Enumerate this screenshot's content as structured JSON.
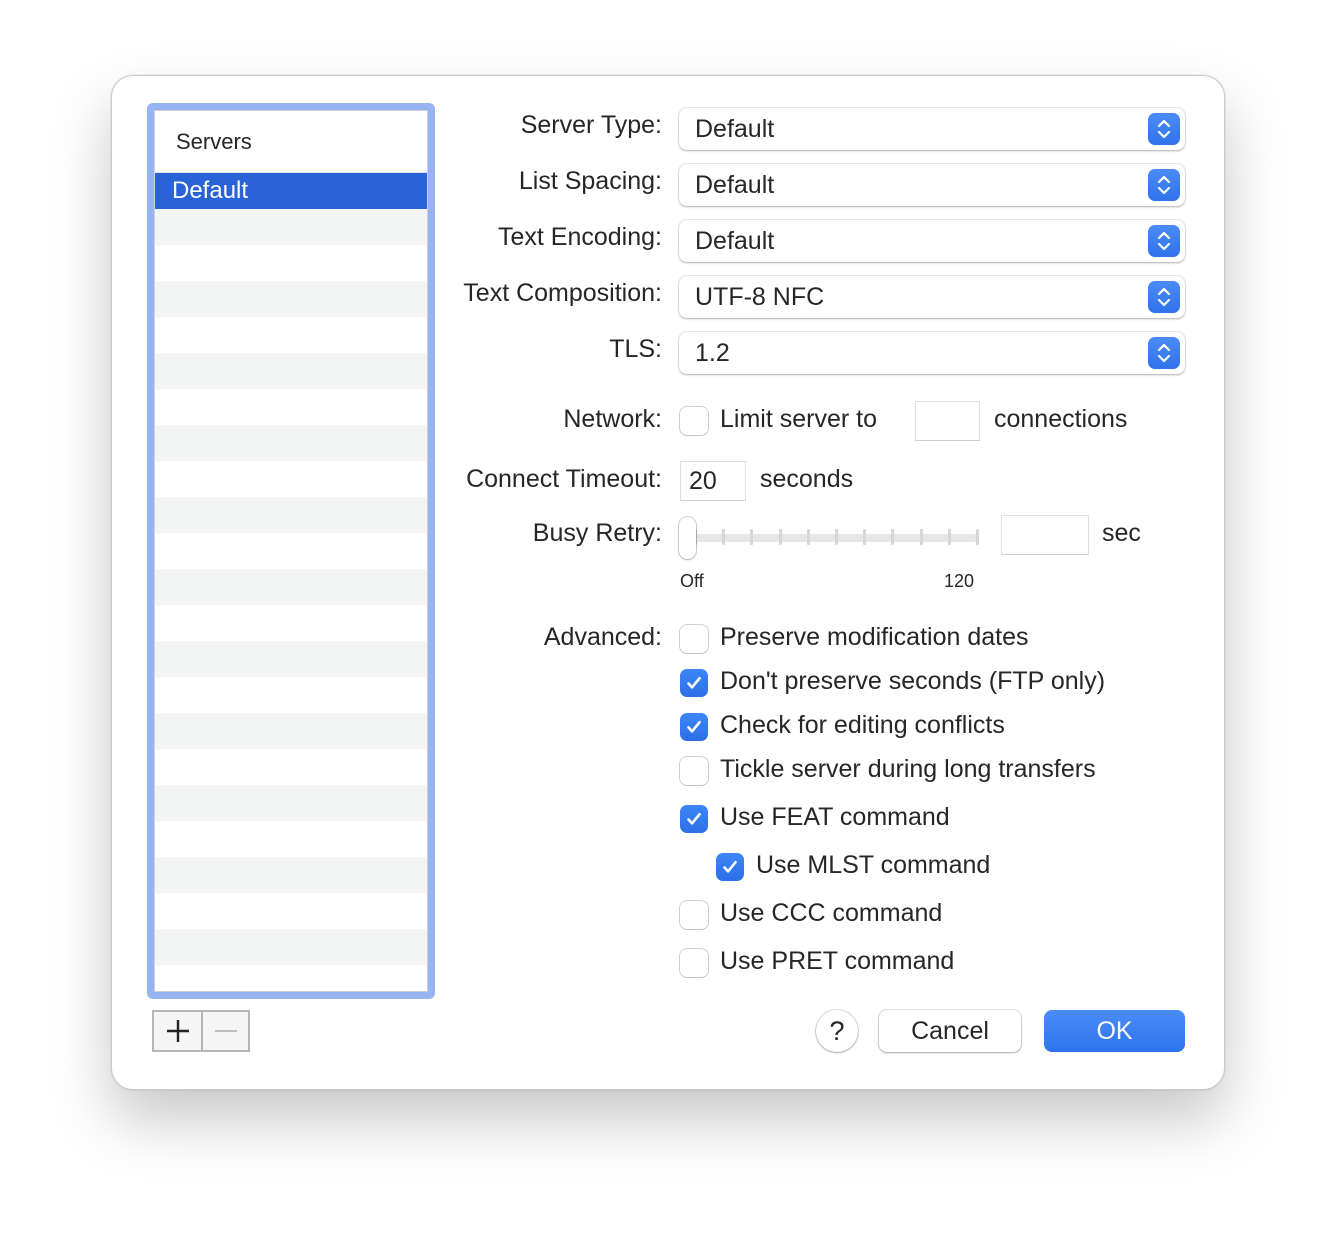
{
  "sidebar": {
    "header": "Servers",
    "items": [
      {
        "label": "Default",
        "selected": true
      }
    ],
    "add_icon": "plus-icon",
    "remove_icon": "minus-icon"
  },
  "form": {
    "server_type": {
      "label": "Server Type:",
      "value": "Default"
    },
    "list_spacing": {
      "label": "List Spacing:",
      "value": "Default"
    },
    "text_encoding": {
      "label": "Text Encoding:",
      "value": "Default"
    },
    "text_composition": {
      "label": "Text Composition:",
      "value": "UTF-8 NFC"
    },
    "tls": {
      "label": "TLS:",
      "value": "1.2"
    },
    "network": {
      "label": "Network:",
      "checkbox_label": "Limit server to",
      "checked": false,
      "connections_value": "",
      "suffix": "connections"
    },
    "connect_timeout": {
      "label": "Connect Timeout:",
      "value": "20",
      "suffix": "seconds"
    },
    "busy_retry": {
      "label": "Busy Retry:",
      "slider_min_label": "Off",
      "slider_max_label": "120",
      "slider_value_fraction": 0,
      "field_value": "",
      "suffix": "sec"
    },
    "advanced": {
      "label": "Advanced:",
      "options": [
        {
          "label": "Preserve modification dates",
          "checked": false
        },
        {
          "label": "Don't preserve seconds (FTP only)",
          "checked": true
        },
        {
          "label": "Check for editing conflicts",
          "checked": true
        },
        {
          "label": "Tickle server during long transfers",
          "checked": false
        },
        {
          "label": "Use FEAT command",
          "checked": true
        },
        {
          "label": "Use MLST command",
          "checked": true
        },
        {
          "label": "Use CCC command",
          "checked": false
        },
        {
          "label": "Use PRET command",
          "checked": false
        }
      ]
    }
  },
  "buttons": {
    "help": "?",
    "cancel": "Cancel",
    "ok": "OK"
  },
  "colors": {
    "accent": "#2e72ee",
    "selection": "#2a63d8",
    "focus_ring": "#96b3f4"
  }
}
